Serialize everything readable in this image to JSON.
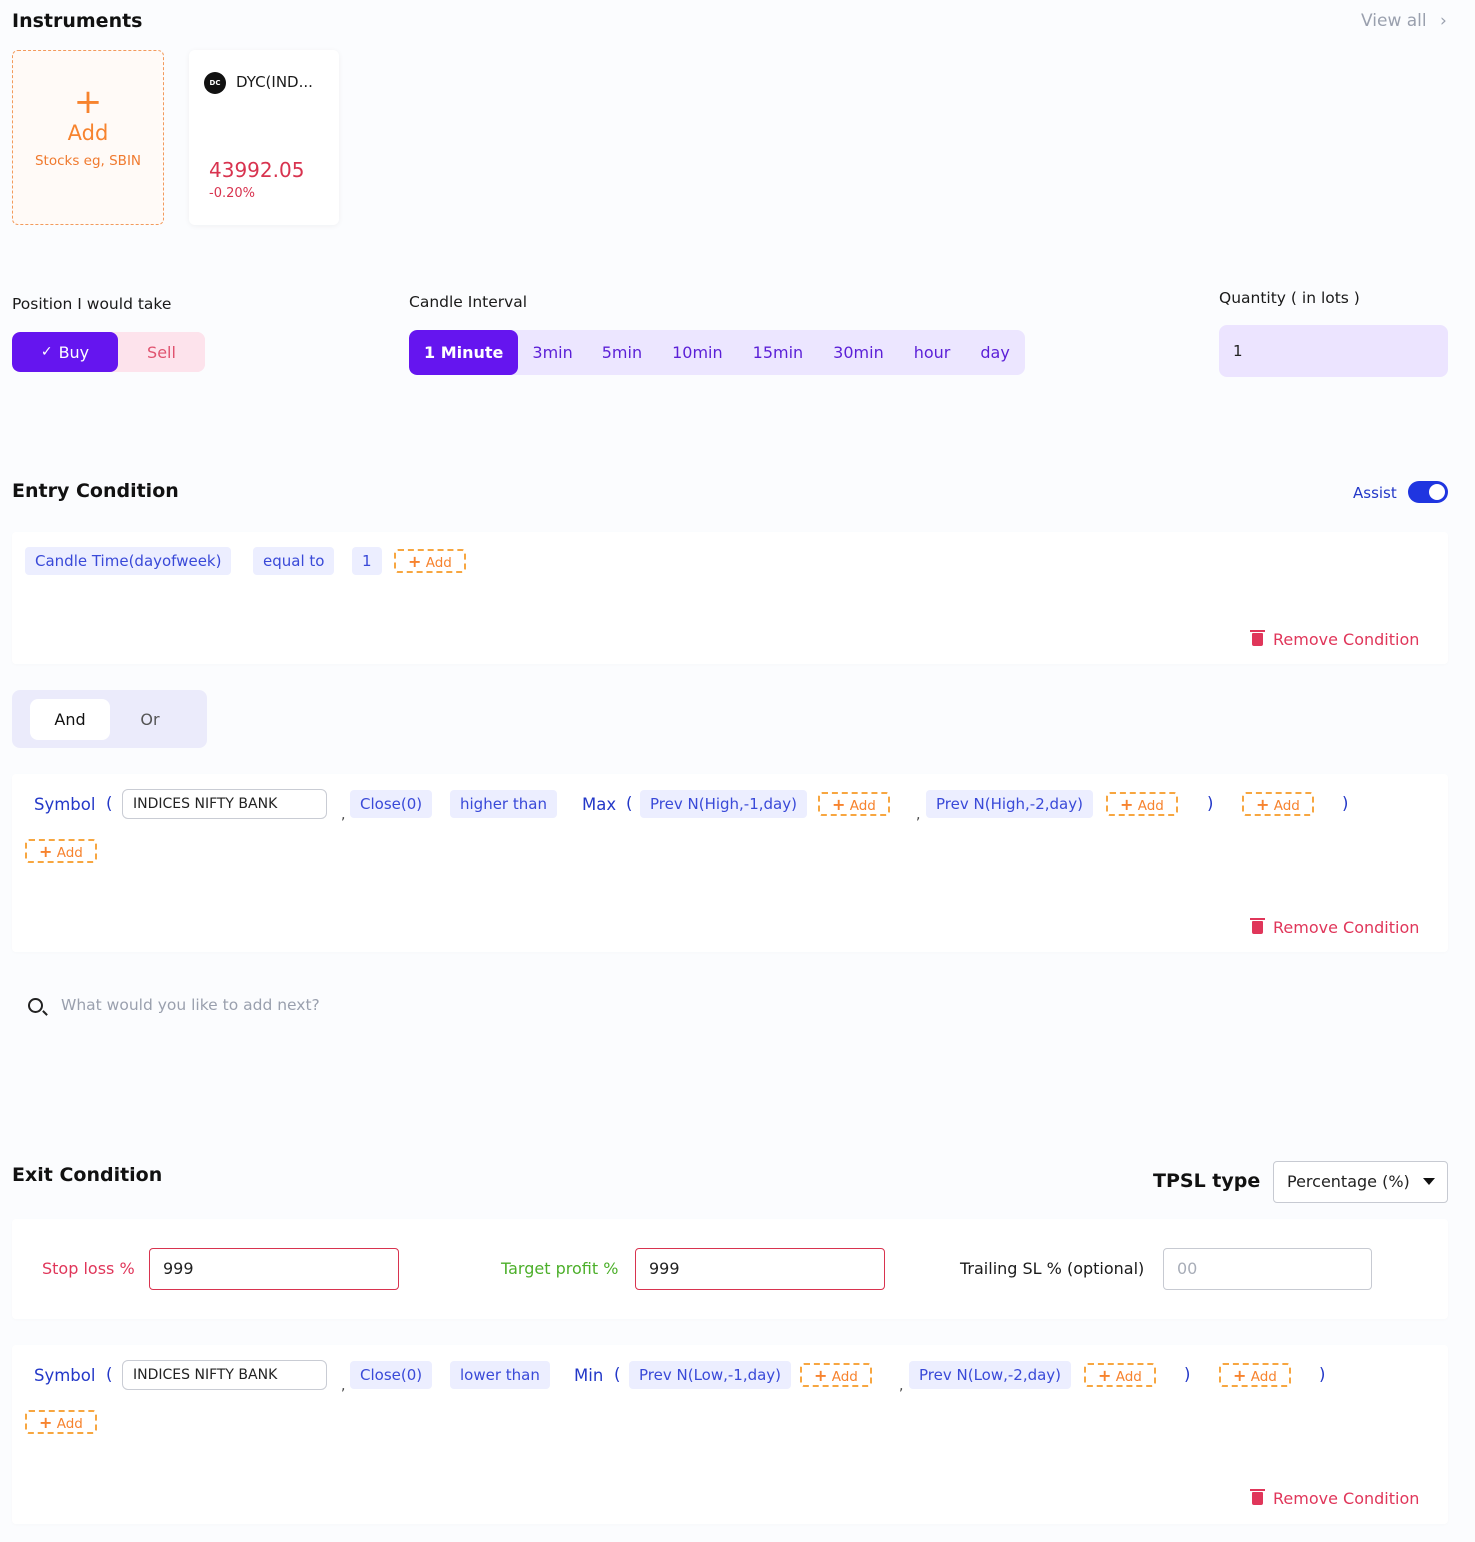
{
  "instruments": {
    "title": "Instruments",
    "view_all": "View all",
    "add_card": {
      "plus": "+",
      "label": "Add",
      "hint": "Stocks eg, SBIN"
    },
    "card": {
      "logo": "DC",
      "name": "DYC(IND...",
      "price": "43992.05",
      "change": "-0.20%"
    }
  },
  "position": {
    "label": "Position I would take",
    "buy": "Buy",
    "sell": "Sell",
    "selected": "Buy"
  },
  "interval": {
    "label": "Candle Interval",
    "options": [
      "1 Minute",
      "3min",
      "5min",
      "10min",
      "15min",
      "30min",
      "hour",
      "day"
    ],
    "selected": "1 Minute"
  },
  "quantity": {
    "label": "Quantity ( in lots )",
    "value": "1"
  },
  "entry": {
    "title": "Entry Condition",
    "assist_label": "Assist",
    "assist_on": true,
    "cond1": {
      "chips": [
        "Candle Time(dayofweek)",
        "equal to",
        "1"
      ],
      "add": "Add",
      "remove": "Remove Condition"
    },
    "logic": {
      "and": "And",
      "or": "Or",
      "selected": "And"
    },
    "cond2": {
      "symbol_kw": "Symbol",
      "open_paren": "(",
      "symbol_value": "INDICES NIFTY BANK",
      "comma": ",",
      "close": "Close(0)",
      "op": "higher than",
      "func": "Max",
      "arg1": "Prev N(High,-1,day)",
      "arg2": "Prev N(High,-2,day)",
      "close_paren": ")",
      "add": "Add",
      "remove": "Remove Condition"
    },
    "search_placeholder": "What would you like to add next?"
  },
  "exit": {
    "title": "Exit Condition",
    "tpsl_label": "TPSL type",
    "tpsl_value": "Percentage (%)",
    "stop_loss_label": "Stop loss %",
    "stop_loss_value": "999",
    "target_label": "Target profit %",
    "target_value": "999",
    "trailing_label": "Trailing SL % (optional)",
    "trailing_placeholder": "00",
    "cond": {
      "symbol_kw": "Symbol",
      "open_paren": "(",
      "symbol_value": "INDICES NIFTY BANK",
      "comma": ",",
      "close": "Close(0)",
      "op": "lower than",
      "func": "Min",
      "arg1": "Prev N(Low,-1,day)",
      "arg2": "Prev N(Low,-2,day)",
      "close_paren": ")",
      "add": "Add",
      "remove": "Remove Condition"
    }
  },
  "colors": {
    "primary": "#6515ef",
    "accent_orange": "#f7832e",
    "danger": "#d8334f",
    "success": "#4caf2a",
    "chip_text": "#3949d8",
    "assist_toggle": "#1f35e0"
  }
}
